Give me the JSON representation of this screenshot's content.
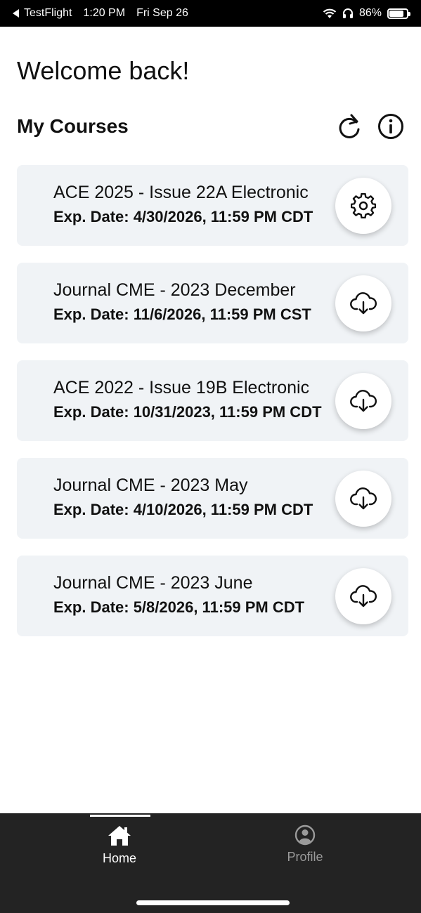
{
  "status_bar": {
    "back_app": "TestFlight",
    "time": "1:20 PM",
    "date": "Fri Sep 26",
    "battery": "86%"
  },
  "header": {
    "welcome": "Welcome back!",
    "section_title": "My Courses"
  },
  "courses": [
    {
      "title": "ACE 2025 - Issue 22A Electronic",
      "exp": "Exp. Date: 4/30/2026, 11:59 PM CDT",
      "action_icon": "gear-icon"
    },
    {
      "title": "Journal CME - 2023 December",
      "exp": "Exp. Date: 11/6/2026, 11:59 PM CST",
      "action_icon": "cloud-download-icon"
    },
    {
      "title": "ACE 2022 - Issue 19B Electronic",
      "exp": "Exp. Date: 10/31/2023, 11:59 PM CDT",
      "action_icon": "cloud-download-icon"
    },
    {
      "title": "Journal CME - 2023 May",
      "exp": "Exp. Date: 4/10/2026, 11:59 PM CDT",
      "action_icon": "cloud-download-icon"
    },
    {
      "title": "Journal CME - 2023 June",
      "exp": "Exp. Date: 5/8/2026, 11:59 PM CDT",
      "action_icon": "cloud-download-icon"
    }
  ],
  "tabs": {
    "home": "Home",
    "profile": "Profile"
  },
  "colors": {
    "card_bg": "#f0f3f6",
    "tab_bar_bg": "#232323",
    "tab_active": "#ffffff",
    "tab_inactive": "#9a9a9a"
  }
}
